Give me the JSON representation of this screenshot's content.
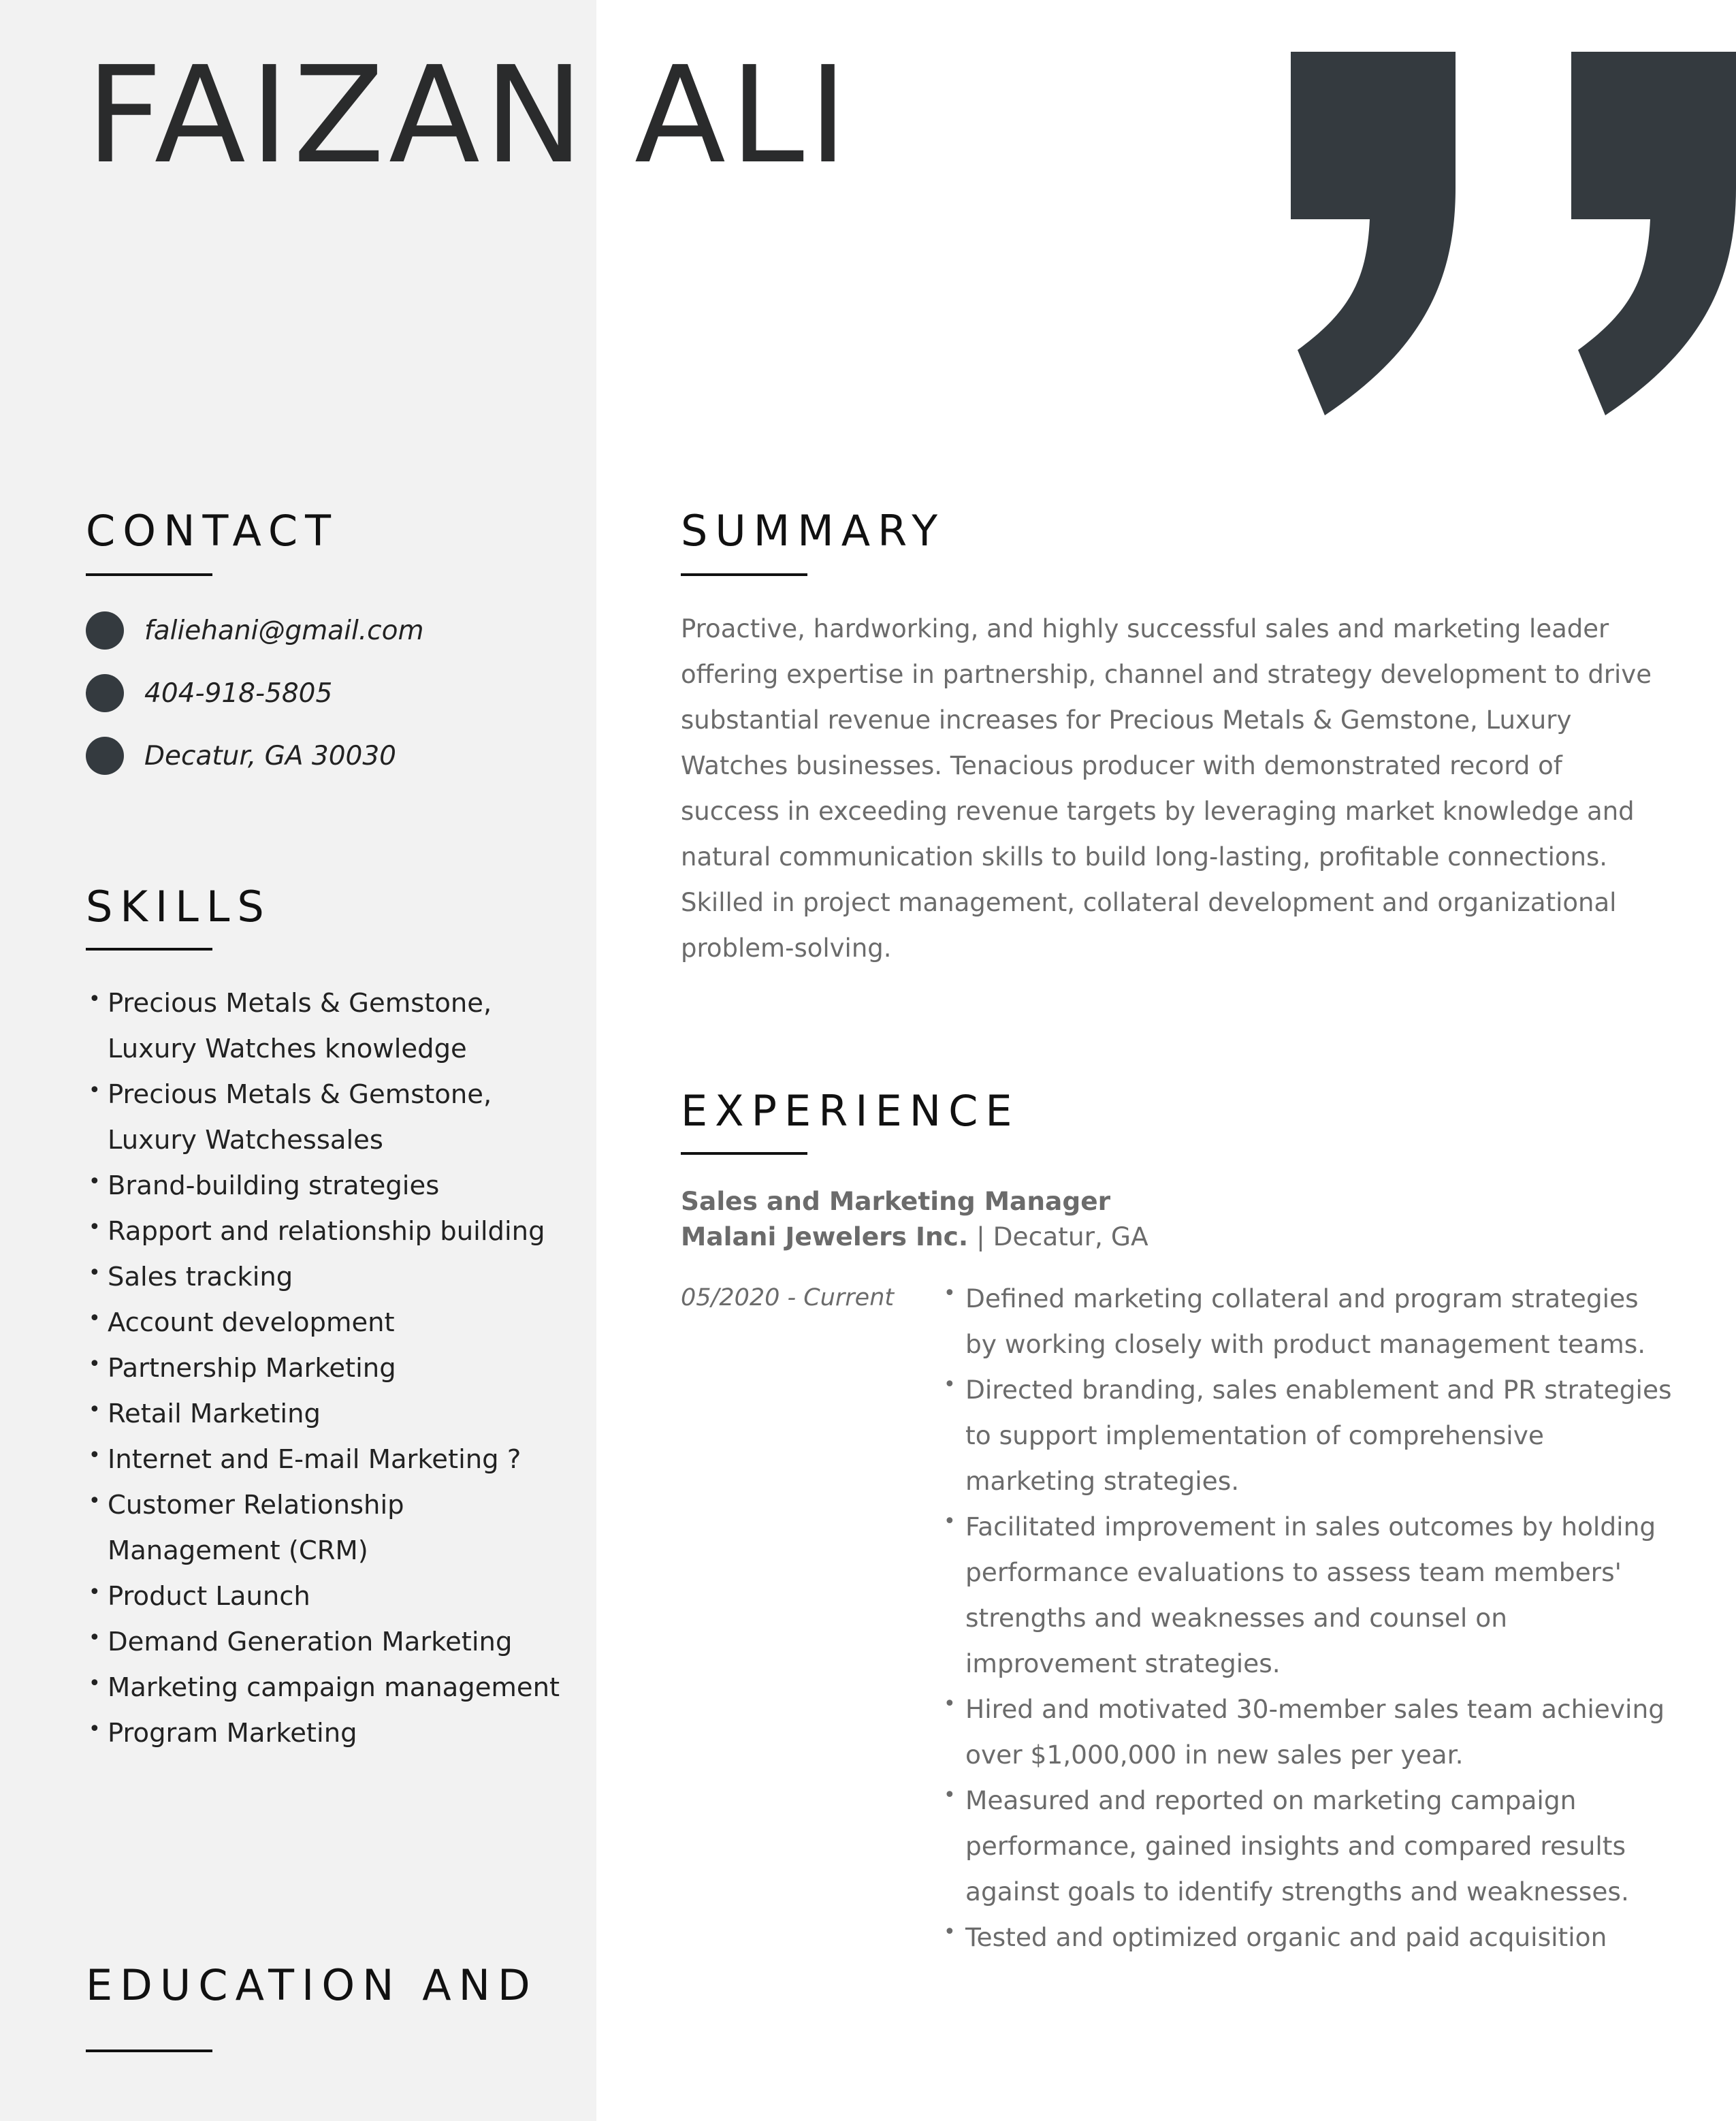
{
  "name": "FAIZAN ALI",
  "contact": {
    "heading": "CONTACT",
    "items": [
      {
        "icon": "email-icon",
        "text": "faliehani@gmail.com"
      },
      {
        "icon": "phone-icon",
        "text": "404-918-5805"
      },
      {
        "icon": "location-icon",
        "text": "Decatur, GA 30030"
      }
    ]
  },
  "skills": {
    "heading": "SKILLS",
    "items": [
      "Precious Metals & Gemstone, Luxury Watches knowledge",
      "Precious Metals & Gemstone, Luxury Watchessales",
      "Brand-building strategies",
      "Rapport and relationship building",
      "Sales tracking",
      "Account development",
      "Partnership Marketing",
      "Retail Marketing",
      "Internet and E-mail Marketing ?",
      "Customer Relationship Management (CRM)",
      "Product Launch",
      "Demand Generation Marketing",
      "Marketing campaign management",
      "Program Marketing"
    ]
  },
  "education": {
    "heading": "EDUCATION AND"
  },
  "summary": {
    "heading": "SUMMARY",
    "text": "Proactive, hardworking, and highly successful sales and marketing leader offering expertise in partnership, channel and strategy development to drive substantial revenue increases for Precious Metals & Gemstone, Luxury Watches businesses. Tenacious producer with demonstrated record of success in exceeding revenue targets by leveraging market knowledge and natural communication skills to build long-lasting, profitable connections. Skilled in project management, collateral development and organizational problem-solving."
  },
  "experience": {
    "heading": "EXPERIENCE",
    "jobs": [
      {
        "title": "Sales and Marketing Manager",
        "company": "Malani Jewelers Inc.",
        "separator": "|",
        "location": "Decatur, GA",
        "dates": "05/2020 - Current",
        "bullets": [
          "Defined marketing collateral and program strategies by working closely with product management teams.",
          "Directed branding, sales enablement and PR strategies to support implementation of comprehensive marketing strategies.",
          "Facilitated improvement in sales outcomes by holding performance evaluations to assess team members' strengths and weaknesses and counsel on improvement strategies.",
          "Hired and motivated 30-member sales team achieving over $1,000,000 in new sales per year.",
          "Measured and reported on marketing campaign performance, gained insights and compared results against goals to identify strengths and weaknesses.",
          "Tested and optimized organic and paid acquisition"
        ]
      }
    ]
  },
  "colors": {
    "sidebar_bg": "#f2f2f2",
    "accent_dark": "#343a3f",
    "body_gray": "#6b6b6b"
  },
  "decor": {
    "quote_icon": "quotation-mark-icon"
  }
}
